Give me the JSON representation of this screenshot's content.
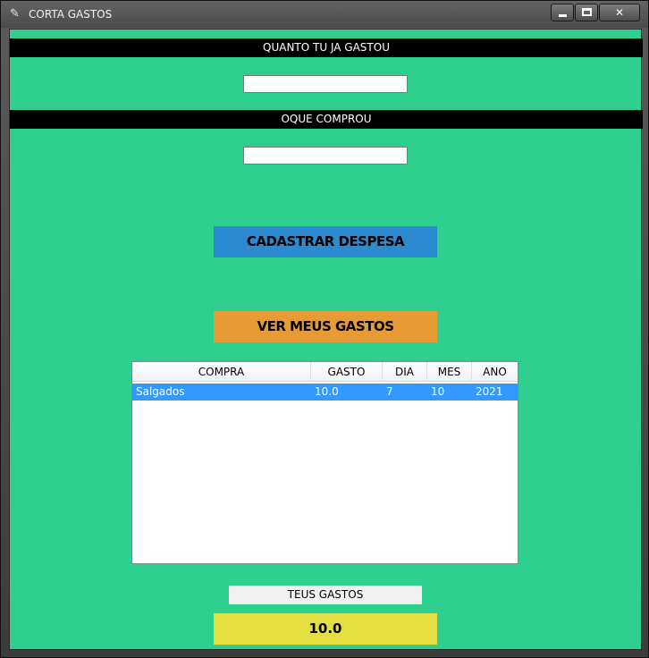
{
  "window": {
    "title": "CORTA GASTOS",
    "icon": "feather-icon",
    "controls": {
      "minimize": "minimize-icon",
      "maximize": "maximize-icon",
      "close": "✕"
    }
  },
  "form": {
    "amount_label": "QUANTO TU JA GASTOU",
    "amount_value": "",
    "item_label": "OQUE COMPROU",
    "item_value": ""
  },
  "buttons": {
    "register": "CADASTRAR DESPESA",
    "view": "VER MEUS GASTOS"
  },
  "table": {
    "columns": [
      "COMPRA",
      "GASTO",
      "DIA",
      "MES",
      "ANO"
    ],
    "rows": [
      {
        "compra": "Salgados",
        "gasto": "10.0",
        "dia": "7",
        "mes": "10",
        "ano": "2021",
        "selected": true
      }
    ]
  },
  "summary": {
    "label": "TEUS GASTOS",
    "total": "10.0"
  },
  "colors": {
    "background": "#2ecf8f",
    "register_button": "#2b8ad0",
    "view_button": "#e79b35",
    "total_box": "#e3df43",
    "selection": "#3399ff"
  }
}
